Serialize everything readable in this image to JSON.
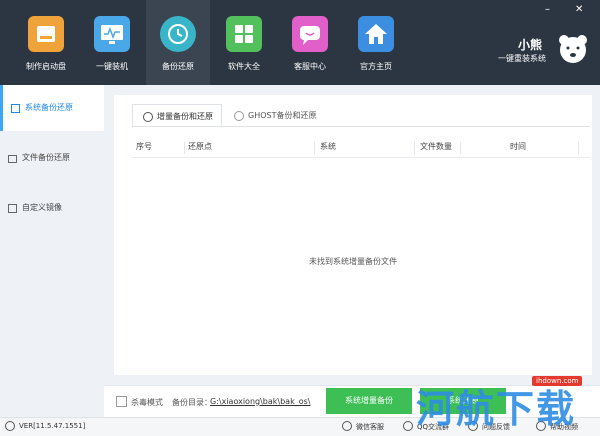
{
  "window": {
    "minimize": "–",
    "close": "✕"
  },
  "nav": [
    {
      "label": "制作启动盘",
      "icon": "usb-disk-icon",
      "color": "#f0a23b"
    },
    {
      "label": "一键装机",
      "icon": "monitor-icon",
      "color": "#4aa8e8"
    },
    {
      "label": "备份还原",
      "icon": "restore-icon",
      "color": "#39b5c9",
      "active": true
    },
    {
      "label": "软件大全",
      "icon": "apps-grid-icon",
      "color": "#52c05b"
    },
    {
      "label": "客服中心",
      "icon": "chat-icon",
      "color": "#e05fc9"
    },
    {
      "label": "官方主页",
      "icon": "home-icon",
      "color": "#3c8fe0"
    }
  ],
  "brand": {
    "name": "小熊",
    "tagline": "一键重装系统"
  },
  "sidebar": [
    {
      "label": "系统备份还原",
      "active": true
    },
    {
      "label": "文件备份还原"
    },
    {
      "label": "自定义镜像"
    }
  ],
  "tabs": [
    {
      "label": "增量备份和还原",
      "active": true
    },
    {
      "label": "GHOST备份和还原"
    }
  ],
  "table": {
    "columns": [
      "序号",
      "还原点",
      "系统",
      "文件数量",
      "时间"
    ],
    "empty_text": "未找到系统增量备份文件"
  },
  "footer": {
    "antivirus_label": "杀毒模式",
    "backup_dir_label": "备份目录：",
    "backup_dir_path": "G:\\xiaoxiong\\bak\\bak_os\\",
    "btn_backup": "系统增量备份",
    "btn_restore": "系统还原"
  },
  "status": {
    "version": "VER[11.5.47.1551]",
    "wechat": "微信客服",
    "qq": "QQ交流群",
    "feedback": "问题反馈",
    "help": "帮助视频"
  },
  "watermark": {
    "text": "河航下载",
    "url": "ihdown.com"
  }
}
